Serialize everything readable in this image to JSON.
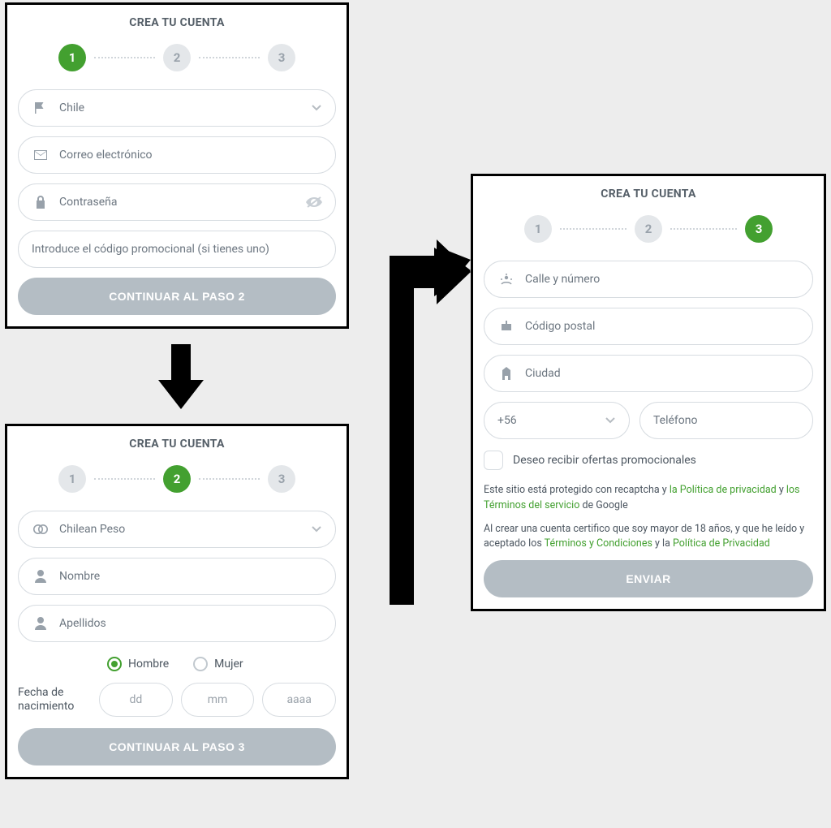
{
  "title": "CREA TU CUENTA",
  "steps": {
    "s1": "1",
    "s2": "2",
    "s3": "3"
  },
  "panel1": {
    "country": "Chile",
    "email_ph": "Correo electrónico",
    "password_ph": "Contraseña",
    "promo_ph": "Introduce el código promocional (si tienes uno)",
    "cta": "CONTINUAR AL PASO 2"
  },
  "panel2": {
    "currency": "Chilean Peso",
    "firstname_ph": "Nombre",
    "lastname_ph": "Apellidos",
    "gender_male": "Hombre",
    "gender_female": "Mujer",
    "dob_label": "Fecha de nacimiento",
    "dob_dd": "dd",
    "dob_mm": "mm",
    "dob_yyyy": "aaaa",
    "cta": "CONTINUAR AL PASO 3"
  },
  "panel3": {
    "street_ph": "Calle y número",
    "zip_ph": "Código postal",
    "city_ph": "Ciudad",
    "dialcode": "+56",
    "phone_ph": "Teléfono",
    "optin": "Deseo recibir ofertas promocionales",
    "legal1_a": "Este sitio está protegido con recaptcha y ",
    "legal1_link1": "la Política de privacidad",
    "legal1_b": " y ",
    "legal1_link2": "los Términos del servicio",
    "legal1_c": " de Google",
    "legal2_a": "Al crear una cuenta certifico que soy mayor de 18 años, y que he leído y aceptado los ",
    "legal2_link1": "Términos y Condiciones",
    "legal2_b": " y la ",
    "legal2_link2": "Política de Privacidad",
    "cta": "ENVIAR"
  }
}
